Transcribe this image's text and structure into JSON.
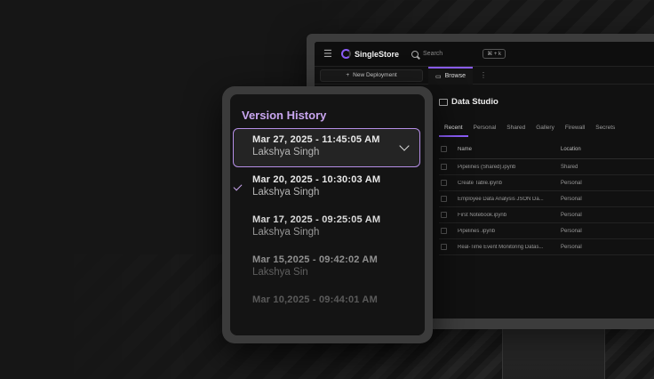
{
  "app": {
    "brand": "SingleStore",
    "search_placeholder": "Search",
    "search_shortcut": "⌘ + k",
    "new_deployment_label": "New Deployment",
    "browse_tab_label": "Browse",
    "more_label": "⋮"
  },
  "page": {
    "title": "Data Studio",
    "filter_tabs": [
      "Recent",
      "Personal",
      "Shared",
      "Gallery",
      "Firewall",
      "Secrets"
    ],
    "active_tab": "Recent"
  },
  "table": {
    "columns": [
      "Name",
      "Location"
    ],
    "rows": [
      {
        "name": "Pipelines (Shared).ipynb",
        "location": "Shared"
      },
      {
        "name": "Create Table.ipynb",
        "location": "Personal"
      },
      {
        "name": "Employee Data Analysis JSON Da...",
        "location": "Personal"
      },
      {
        "name": "First Notebook.ipynb",
        "location": "Personal"
      },
      {
        "name": "Pipelines .ipynb",
        "location": "Personal"
      },
      {
        "name": "Real-Time Event Monitoring Datas...",
        "location": "Personal"
      }
    ]
  },
  "version_history": {
    "title": "Version History",
    "items": [
      {
        "date": "Mar 27, 2025 - 11:45:05 AM",
        "user": "Lakshya Singh"
      },
      {
        "date": "Mar 20, 2025 - 10:30:03 AM",
        "user": "Lakshya Singh"
      },
      {
        "date": "Mar 17, 2025 - 09:25:05 AM",
        "user": "Lakshya Singh"
      },
      {
        "date": "Mar 15,2025 - 09:42:02 AM",
        "user": "Lakshya Sin"
      },
      {
        "date": "Mar 10,2025 - 09:44:01 AM",
        "user": ""
      }
    ]
  },
  "colors": {
    "accent": "#8a5cf6",
    "title_lilac": "#c9a6f0",
    "background": "#161616"
  }
}
